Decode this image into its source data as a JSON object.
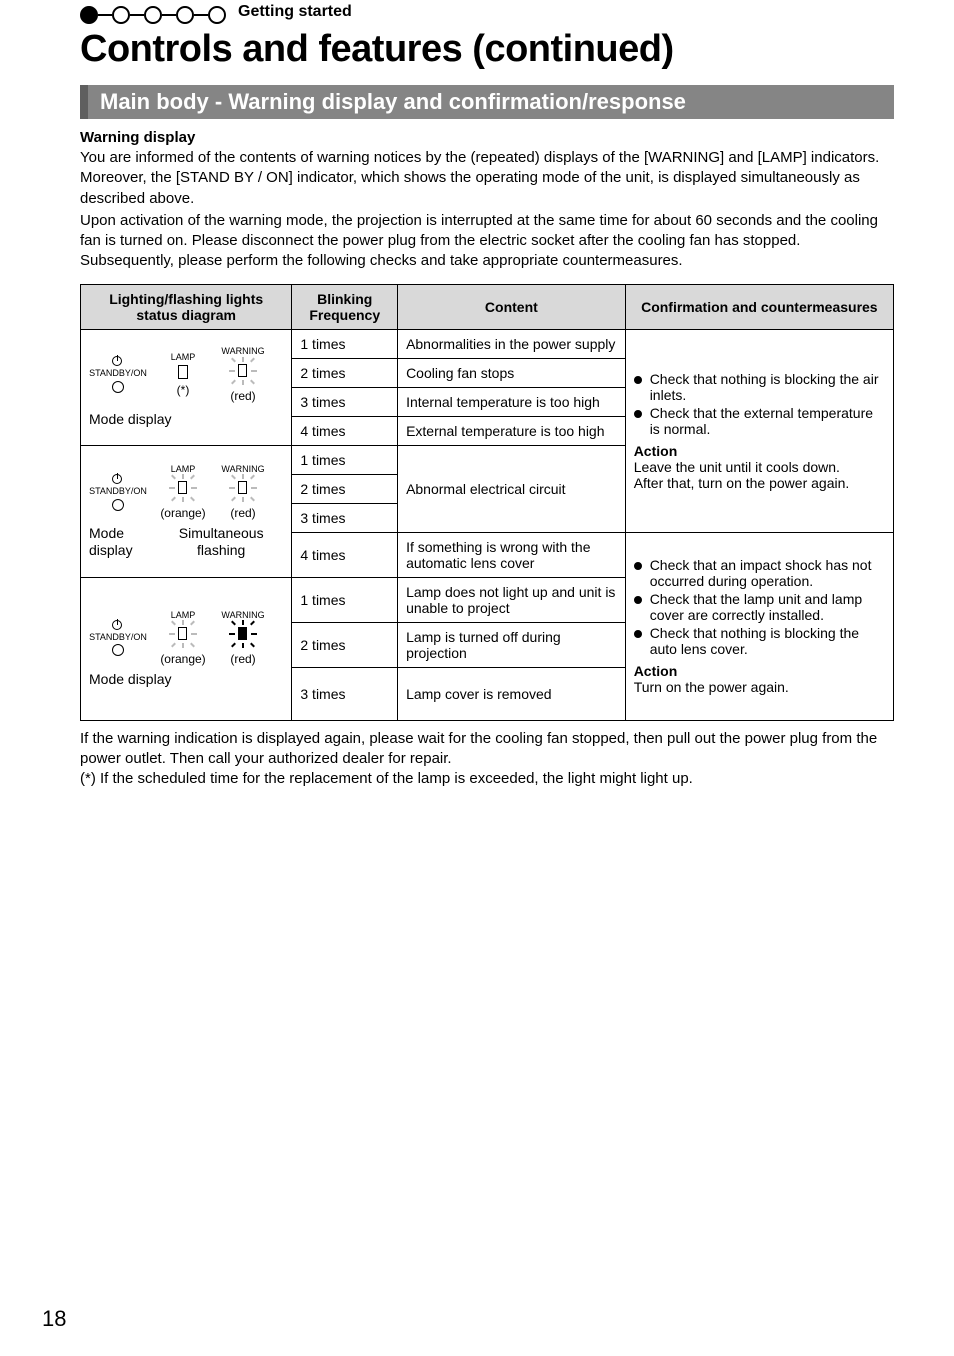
{
  "progress": {
    "label": "Getting started"
  },
  "page_title": "Controls and features (continued)",
  "section_bar": "Main body - Warning display and confirmation/response",
  "subhead": "Warning display",
  "intro_p1": "You are informed of the contents of warning notices by the (repeated) displays of the [WARNING] and [LAMP] indicators. Moreover, the [STAND BY / ON] indicator, which shows the operating mode of the unit, is displayed simultaneously as described above.",
  "intro_p2": "Upon activation of the warning mode, the projection is interrupted at the same time for about 60 seconds and the cooling fan is turned on. Please disconnect the power plug from the electric socket after the cooling fan has stopped. Subsequently, please perform the following checks and take appropriate countermeasures.",
  "table": {
    "headers": {
      "c1": "Lighting/flashing lights status diagram",
      "c2": "Blinking Frequency",
      "c3": "Content",
      "c4": "Confirmation and countermeasures"
    },
    "diag1": {
      "standby": "STANDBY/ON",
      "lamp": "LAMP",
      "warning": "WARNING",
      "star": "(*)",
      "red": "(red)",
      "mode": "Mode display"
    },
    "diag2": {
      "standby": "STANDBY/ON",
      "lamp": "LAMP",
      "warning": "WARNING",
      "orange": "(orange)",
      "red": "(red)",
      "mode": "Mode display",
      "simul": "Simultaneous flashing"
    },
    "diag3": {
      "standby": "STANDBY/ON",
      "lamp": "LAMP",
      "warning": "WARNING",
      "orange": "(orange)",
      "red": "(red)",
      "mode": "Mode display"
    },
    "rows": {
      "r1": {
        "freq": "1 times",
        "content": "Abnormalities in the power supply"
      },
      "r2": {
        "freq": "2 times",
        "content": "Cooling fan stops"
      },
      "r3": {
        "freq": "3 times",
        "content": "Internal temperature is too high"
      },
      "r4": {
        "freq": "4 times",
        "content": "External temperature is too high"
      },
      "r5": {
        "freq": "1 times"
      },
      "r6": {
        "freq": "2 times",
        "content": "Abnormal electrical circuit"
      },
      "r7": {
        "freq": "3 times"
      },
      "r8": {
        "freq": "4 times",
        "content": "If something is wrong with the automatic lens cover"
      },
      "r9": {
        "freq": "1 times",
        "content": "Lamp does not light up and unit is unable to project"
      },
      "r10": {
        "freq": "2 times",
        "content": "Lamp is turned off during projection"
      },
      "r11": {
        "freq": "3 times",
        "content": "Lamp cover is removed"
      }
    },
    "counter1": {
      "b1": "Check that nothing is blocking the air inlets.",
      "b2": "Check that the external temperature is normal.",
      "action_label": "Action",
      "action_text1": "Leave the unit until it cools down.",
      "action_text2": "After that, turn on the power again."
    },
    "counter2": {
      "b1": "Check that an impact shock has not occurred during operation.",
      "b2": "Check that the lamp unit and lamp cover are correctly installed.",
      "b3": "Check that nothing is blocking the auto lens cover.",
      "action_label": "Action",
      "action_text": "Turn on the power again."
    }
  },
  "footer_p1": "If the warning indication is displayed again, please wait for the cooling fan stopped, then pull out the power plug from the power outlet.  Then call your authorized dealer for repair.",
  "footer_p2": "(*) If the scheduled time for the replacement of the lamp is exceeded, the light might light up.",
  "page_number": "18"
}
